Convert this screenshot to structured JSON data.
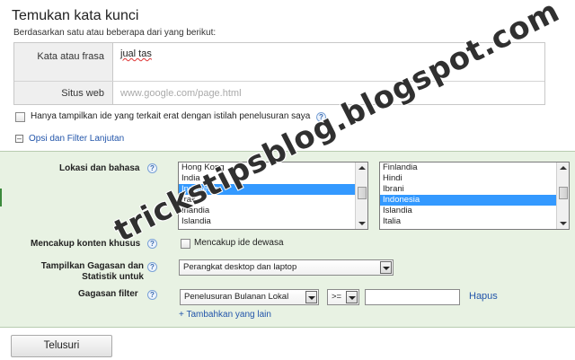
{
  "header": {
    "title": "Temukan kata kunci",
    "subtitle": "Berdasarkan satu atau beberapa dari yang berikut:"
  },
  "keyword_form": {
    "phrase_label": "Kata atau frasa",
    "phrase_value": "jual tas",
    "website_label": "Situs web",
    "website_placeholder": "www.google.com/page.html"
  },
  "filters": {
    "closely_related_label": "Hanya tampilkan ide yang terkait erat dengan istilah penelusuran saya",
    "advanced_link": "Opsi dan Filter Lanjutan"
  },
  "advanced": {
    "location_label": "Lokasi dan bahasa",
    "locations": [
      "Hong Kong",
      "India",
      "Indonesia",
      "Irak",
      "Irlandia",
      "Islandia"
    ],
    "selected_location": "Indonesia",
    "languages": [
      "Finlandia",
      "Hindi",
      "Ibrani",
      "Indonesia",
      "Islandia",
      "Italia"
    ],
    "selected_language": "Indonesia",
    "special_content_label": "Mencakup konten khusus",
    "adult_ideas_label": "Mencakup ide dewasa",
    "show_ideas_label": "Tampilkan Gagasan dan Statistik untuk",
    "device_value": "Perangkat desktop dan laptop",
    "idea_filter_label": "Gagasan filter",
    "filter_metric": "Penelusuran Bulanan Lokal",
    "filter_operator": ">=",
    "filter_value": "",
    "delete_link": "Hapus",
    "add_more_link": "+ Tambahkan yang lain"
  },
  "search_button": "Telusuri",
  "watermark": "trickstipsblog.blogspot.com",
  "colors": {
    "panel_bg": "#e8f2e3",
    "selection": "#3399ff",
    "link": "#2255aa"
  }
}
